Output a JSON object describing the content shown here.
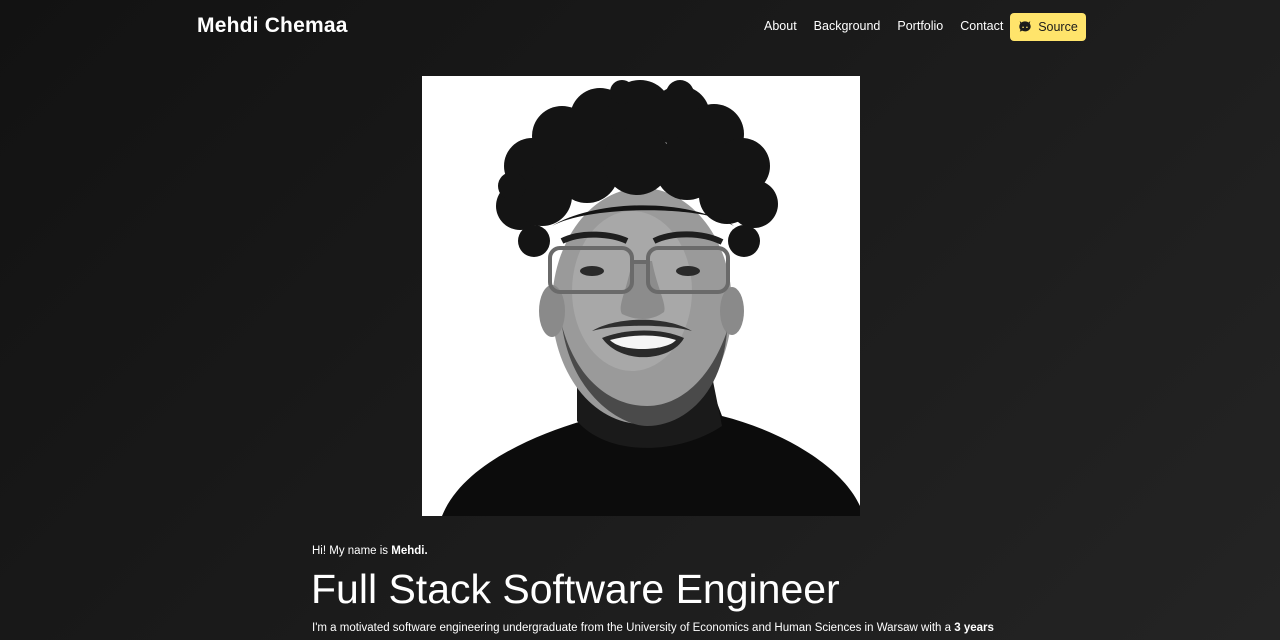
{
  "nav": {
    "brand": "Mehdi Chemaa",
    "links": [
      "About",
      "Background",
      "Portfolio",
      "Contact"
    ],
    "source_label": "Source",
    "source_icon": "github-icon"
  },
  "hero": {
    "intro_prefix": "Hi! My name is ",
    "intro_name": "Mehdi.",
    "headline": "Full Stack Software Engineer",
    "bio_text": "I'm a motivated software engineering undergraduate from the University of Economics and Human Sciences in Warsaw with a ",
    "bio_bold": "3 years",
    "portrait_subject": "profile-photo"
  },
  "colors": {
    "accent": "#ffe46b",
    "background": "#161616",
    "text": "#ffffff"
  }
}
